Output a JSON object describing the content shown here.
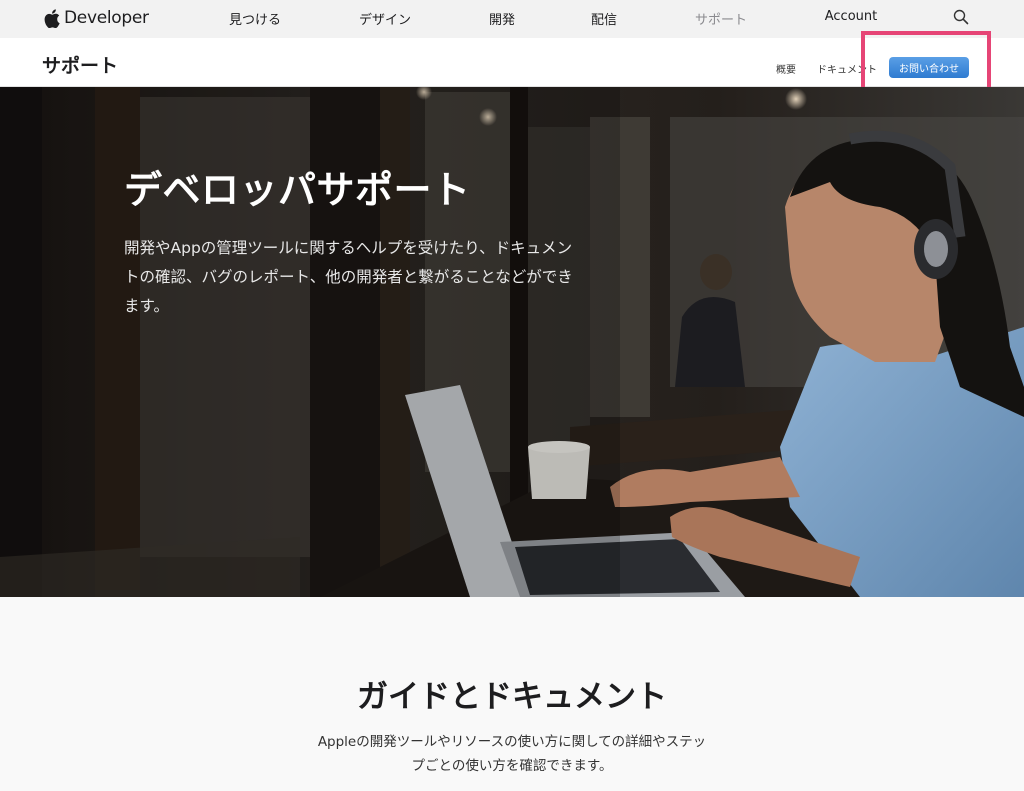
{
  "globalnav": {
    "brand": "Developer",
    "links": [
      "見つける",
      "デザイン",
      "開発",
      "配信",
      "サポート",
      "Account"
    ],
    "current": "サポート",
    "search_icon": "search-icon"
  },
  "localnav": {
    "title": "サポート",
    "links": [
      "概要",
      "ドキュメント"
    ],
    "contact_button": "お問い合わせ",
    "highlight_color": "#e64576",
    "button_color": "#3d86d8"
  },
  "hero": {
    "title": "デベロッパサポート",
    "description": "開発やAppの管理ツールに関するヘルプを受けたり、ドキュメントの確認、バグのレポート、他の開発者と繋がることなどができます。"
  },
  "section": {
    "title": "ガイドとドキュメント",
    "description": "Appleの開発ツールやリソースの使い方に関しての詳細やステップごとの使い方を確認できます。"
  }
}
